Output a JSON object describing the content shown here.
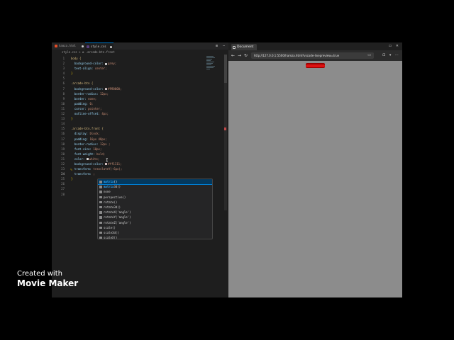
{
  "editor": {
    "tabs": [
      {
        "label": "hamza.html",
        "icon": "html-file-icon",
        "color": "#e34c26",
        "active": false
      },
      {
        "label": "style.css",
        "icon": "css-file-icon",
        "color": "#563d7c",
        "active": true
      }
    ],
    "breadcrumb": "style.css > ⚙ .arcade-btn.front",
    "line_numbers": [
      "1",
      "2",
      "3",
      "4",
      "5",
      "6",
      "7",
      "8",
      "9",
      "10",
      "11",
      "12",
      "13",
      "14",
      "15",
      "16",
      "17",
      "18",
      "19",
      "20",
      "21",
      "22",
      "23",
      "24",
      "25",
      "26",
      "27",
      "28"
    ],
    "current_line": "24",
    "code": [
      {
        "sel": "body {"
      },
      {
        "prop": "  background-color: ",
        "swatch": "#808080",
        "val": "grey;"
      },
      {
        "prop": "  text-align: ",
        "val": "center;"
      },
      {
        "brace": "}"
      },
      {
        "plain": ""
      },
      {
        "sel": ".arcade-btn {"
      },
      {
        "prop": "  background-color: ",
        "swatch": "#990000",
        "val": "#990000;"
      },
      {
        "prop": "  border-radius: ",
        "val": "12px;"
      },
      {
        "prop": "  border: ",
        "val": "none;"
      },
      {
        "prop": "  padding: ",
        "val": "0;"
      },
      {
        "prop": "  cursor: ",
        "val": "pointer;"
      },
      {
        "prop": "  outline-offset: ",
        "val": "4px;"
      },
      {
        "brace": "}"
      },
      {
        "plain": ""
      },
      {
        "sel": ".arcade-btn.front {"
      },
      {
        "prop": "  display: ",
        "val": "block;"
      },
      {
        "prop": "  padding: ",
        "val": "16px 48px;"
      },
      {
        "prop": "  border-radius: ",
        "val": "12px ;"
      },
      {
        "prop": "  font-size: ",
        "val": "18px;"
      },
      {
        "prop": "  font-weight: ",
        "val": "bold;"
      },
      {
        "prop": "  color: ",
        "swatch": "#ffffff",
        "val": "white;"
      },
      {
        "prop": "  background-color: ",
        "swatch": "#ff1111",
        "val": "#ff1111;"
      },
      {
        "prop": "  transform: ",
        "val": "translateY(-6px);"
      },
      {
        "prop": "  transform: ",
        "val": ";"
      },
      {
        "brace": "}"
      },
      {
        "plain": ""
      },
      {
        "plain": ""
      },
      {
        "plain": ""
      }
    ],
    "suggestions": [
      {
        "match": "matrix",
        "rest": "()",
        "active": true
      },
      {
        "match": "matrix",
        "rest": "3d()",
        "active": false
      },
      {
        "match": "",
        "rest": "none",
        "active": false
      },
      {
        "match": "",
        "rest": "perspective()",
        "active": false
      },
      {
        "match": "",
        "rest": "rotate()",
        "active": false
      },
      {
        "match": "",
        "rest": "rotate3d()",
        "active": false
      },
      {
        "match": "",
        "rest": "rotateX('angle')",
        "active": false
      },
      {
        "match": "",
        "rest": "rotateY('angle')",
        "active": false
      },
      {
        "match": "",
        "rest": "rotateZ('angle')",
        "active": false
      },
      {
        "match": "",
        "rest": "scale()",
        "active": false
      },
      {
        "match": "",
        "rest": "scale3d()",
        "active": false
      },
      {
        "match": "",
        "rest": "scaleX()",
        "active": false
      }
    ],
    "actions": "⊞ ⋯"
  },
  "browser": {
    "tab_title": "Document",
    "url": "http://127.0.0.1:5500/hamza.html?vscode-livepreview=true",
    "nav": {
      "back": "←",
      "forward": "→",
      "reload": "↻"
    },
    "url_icon": "▭",
    "window_controls": "▭ ✕",
    "toolbar_right": "⊡ ▾ ⋯",
    "viewport_bg": "#8c8c8c",
    "button": {
      "label": "",
      "back_color": "#990000",
      "front_color": "#dd1111"
    }
  },
  "watermark": {
    "line1": "Created with",
    "line2": "Movie Maker"
  }
}
